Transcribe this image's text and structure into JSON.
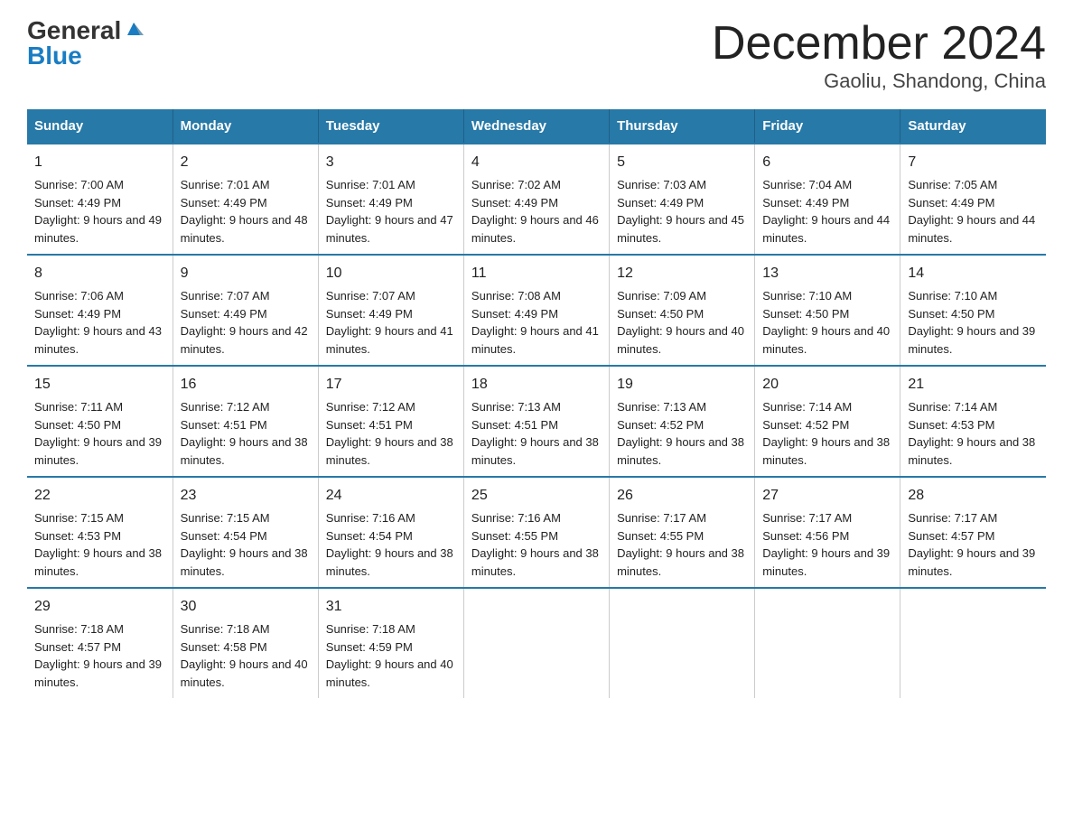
{
  "logo": {
    "general": "General",
    "blue": "Blue"
  },
  "title": "December 2024",
  "subtitle": "Gaoliu, Shandong, China",
  "days_of_week": [
    "Sunday",
    "Monday",
    "Tuesday",
    "Wednesday",
    "Thursday",
    "Friday",
    "Saturday"
  ],
  "weeks": [
    [
      {
        "day": "1",
        "sunrise": "7:00 AM",
        "sunset": "4:49 PM",
        "daylight": "9 hours and 49 minutes."
      },
      {
        "day": "2",
        "sunrise": "7:01 AM",
        "sunset": "4:49 PM",
        "daylight": "9 hours and 48 minutes."
      },
      {
        "day": "3",
        "sunrise": "7:01 AM",
        "sunset": "4:49 PM",
        "daylight": "9 hours and 47 minutes."
      },
      {
        "day": "4",
        "sunrise": "7:02 AM",
        "sunset": "4:49 PM",
        "daylight": "9 hours and 46 minutes."
      },
      {
        "day": "5",
        "sunrise": "7:03 AM",
        "sunset": "4:49 PM",
        "daylight": "9 hours and 45 minutes."
      },
      {
        "day": "6",
        "sunrise": "7:04 AM",
        "sunset": "4:49 PM",
        "daylight": "9 hours and 44 minutes."
      },
      {
        "day": "7",
        "sunrise": "7:05 AM",
        "sunset": "4:49 PM",
        "daylight": "9 hours and 44 minutes."
      }
    ],
    [
      {
        "day": "8",
        "sunrise": "7:06 AM",
        "sunset": "4:49 PM",
        "daylight": "9 hours and 43 minutes."
      },
      {
        "day": "9",
        "sunrise": "7:07 AM",
        "sunset": "4:49 PM",
        "daylight": "9 hours and 42 minutes."
      },
      {
        "day": "10",
        "sunrise": "7:07 AM",
        "sunset": "4:49 PM",
        "daylight": "9 hours and 41 minutes."
      },
      {
        "day": "11",
        "sunrise": "7:08 AM",
        "sunset": "4:49 PM",
        "daylight": "9 hours and 41 minutes."
      },
      {
        "day": "12",
        "sunrise": "7:09 AM",
        "sunset": "4:50 PM",
        "daylight": "9 hours and 40 minutes."
      },
      {
        "day": "13",
        "sunrise": "7:10 AM",
        "sunset": "4:50 PM",
        "daylight": "9 hours and 40 minutes."
      },
      {
        "day": "14",
        "sunrise": "7:10 AM",
        "sunset": "4:50 PM",
        "daylight": "9 hours and 39 minutes."
      }
    ],
    [
      {
        "day": "15",
        "sunrise": "7:11 AM",
        "sunset": "4:50 PM",
        "daylight": "9 hours and 39 minutes."
      },
      {
        "day": "16",
        "sunrise": "7:12 AM",
        "sunset": "4:51 PM",
        "daylight": "9 hours and 38 minutes."
      },
      {
        "day": "17",
        "sunrise": "7:12 AM",
        "sunset": "4:51 PM",
        "daylight": "9 hours and 38 minutes."
      },
      {
        "day": "18",
        "sunrise": "7:13 AM",
        "sunset": "4:51 PM",
        "daylight": "9 hours and 38 minutes."
      },
      {
        "day": "19",
        "sunrise": "7:13 AM",
        "sunset": "4:52 PM",
        "daylight": "9 hours and 38 minutes."
      },
      {
        "day": "20",
        "sunrise": "7:14 AM",
        "sunset": "4:52 PM",
        "daylight": "9 hours and 38 minutes."
      },
      {
        "day": "21",
        "sunrise": "7:14 AM",
        "sunset": "4:53 PM",
        "daylight": "9 hours and 38 minutes."
      }
    ],
    [
      {
        "day": "22",
        "sunrise": "7:15 AM",
        "sunset": "4:53 PM",
        "daylight": "9 hours and 38 minutes."
      },
      {
        "day": "23",
        "sunrise": "7:15 AM",
        "sunset": "4:54 PM",
        "daylight": "9 hours and 38 minutes."
      },
      {
        "day": "24",
        "sunrise": "7:16 AM",
        "sunset": "4:54 PM",
        "daylight": "9 hours and 38 minutes."
      },
      {
        "day": "25",
        "sunrise": "7:16 AM",
        "sunset": "4:55 PM",
        "daylight": "9 hours and 38 minutes."
      },
      {
        "day": "26",
        "sunrise": "7:17 AM",
        "sunset": "4:55 PM",
        "daylight": "9 hours and 38 minutes."
      },
      {
        "day": "27",
        "sunrise": "7:17 AM",
        "sunset": "4:56 PM",
        "daylight": "9 hours and 39 minutes."
      },
      {
        "day": "28",
        "sunrise": "7:17 AM",
        "sunset": "4:57 PM",
        "daylight": "9 hours and 39 minutes."
      }
    ],
    [
      {
        "day": "29",
        "sunrise": "7:18 AM",
        "sunset": "4:57 PM",
        "daylight": "9 hours and 39 minutes."
      },
      {
        "day": "30",
        "sunrise": "7:18 AM",
        "sunset": "4:58 PM",
        "daylight": "9 hours and 40 minutes."
      },
      {
        "day": "31",
        "sunrise": "7:18 AM",
        "sunset": "4:59 PM",
        "daylight": "9 hours and 40 minutes."
      },
      {
        "day": "",
        "sunrise": "",
        "sunset": "",
        "daylight": ""
      },
      {
        "day": "",
        "sunrise": "",
        "sunset": "",
        "daylight": ""
      },
      {
        "day": "",
        "sunrise": "",
        "sunset": "",
        "daylight": ""
      },
      {
        "day": "",
        "sunrise": "",
        "sunset": "",
        "daylight": ""
      }
    ]
  ]
}
